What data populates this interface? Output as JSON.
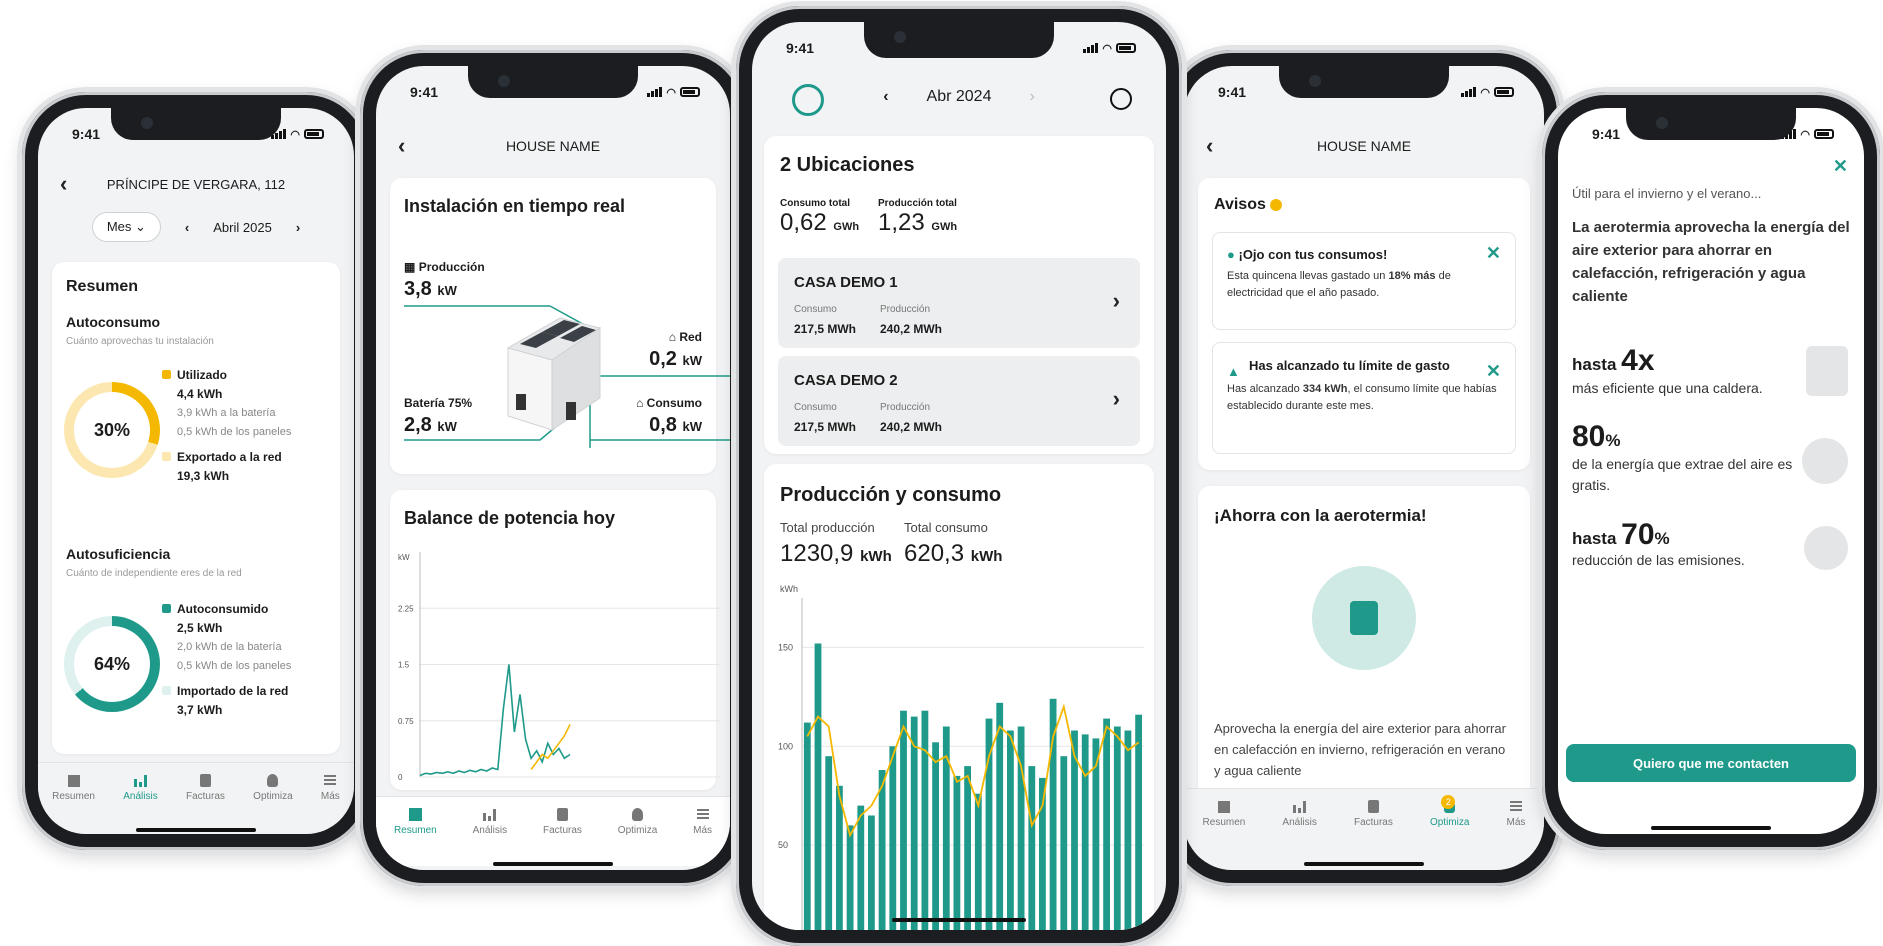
{
  "theme": {
    "accent": "#1f9a8a",
    "yellow": "#f5b800",
    "yellow_light": "#fde7b0",
    "teal_light": "#dff1ee"
  },
  "status_time": "9:41",
  "phone1": {
    "title": "PRÍNCIPE DE VERGARA, 112",
    "period_select": "Mes",
    "month": "Abril 2025",
    "summary_title": "Resumen",
    "autoconsumo": {
      "title": "Autoconsumo",
      "subtitle": "Cuánto aprovechas tu instalación",
      "percent": "30%",
      "percent_value": 0.3,
      "used_label": "Utilizado",
      "used_value": "4,4 kWh",
      "used_battery": "3,9 kWh a la batería",
      "used_panels": "0,5 kWh de los paneles",
      "exported_label": "Exportado a la red",
      "exported_value": "19,3 kWh"
    },
    "autosuficiencia": {
      "title": "Autosuficiencia",
      "subtitle": "Cuánto de independiente eres de la red",
      "percent": "64%",
      "percent_value": 0.64,
      "self_label": "Autoconsumido",
      "self_value": "2,5 kWh",
      "self_battery": "2,0 kWh de la batería",
      "self_panels": "0,5 kWh de los paneles",
      "imported_label": "Importado de la red",
      "imported_value": "3,7 kWh"
    },
    "tabs": [
      "Resumen",
      "Análisis",
      "Facturas",
      "Optimiza",
      "Más"
    ]
  },
  "phone2": {
    "title": "HOUSE NAME",
    "realtime_title": "Instalación en tiempo real",
    "production_label": "Producción",
    "production_value": "3,8",
    "grid_label": "Red",
    "grid_value": "0,2",
    "battery_label": "Batería 75%",
    "battery_value": "2,8",
    "consumption_label": "Consumo",
    "consumption_value": "0,8",
    "unit": "kW",
    "balance_title": "Balance de potencia hoy",
    "chart_unit": "kW",
    "yticks": [
      "2.25",
      "1.5",
      "0.75",
      "0"
    ],
    "tabs": [
      "Resumen",
      "Análisis",
      "Facturas",
      "Optimiza",
      "Más"
    ]
  },
  "phone3": {
    "month": "Abr 2024",
    "locations_title": "2 Ubicaciones",
    "total_consumption_label": "Consumo total",
    "total_consumption_value": "0,62",
    "total_production_label": "Producción total",
    "total_production_value": "1,23",
    "gwh": "GWh",
    "houses": [
      {
        "name": "CASA DEMO 1",
        "consumo_label": "Consumo",
        "consumo": "217,5 MWh",
        "produccion_label": "Producción",
        "produccion": "240,2 MWh"
      },
      {
        "name": "CASA DEMO 2",
        "consumo_label": "Consumo",
        "consumo": "217,5 MWh",
        "produccion_label": "Producción",
        "produccion": "240,2 MWh"
      }
    ],
    "prod_title": "Producción y consumo",
    "total_prod_label": "Total producción",
    "total_prod_value": "1230,9",
    "total_cons_label": "Total consumo",
    "total_cons_value": "620,3",
    "kwh": "kWh",
    "chart_unit": "kWh",
    "yticks": [
      "150",
      "100",
      "50"
    ]
  },
  "phone4": {
    "title": "HOUSE NAME",
    "alerts_title": "Avisos",
    "alert1_title": "¡Ojo con tus consumos!",
    "alert1_text_a": "Esta quincena llevas gastado un ",
    "alert1_text_b": "18% más",
    "alert1_text_c": " de electricidad que el año pasado.",
    "alert2_title": "Has alcanzado tu límite de gasto",
    "alert2_text_a": "Has alcanzado ",
    "alert2_text_b": "334 kWh",
    "alert2_text_c": ", el consumo límite que habías establecido durante este mes.",
    "promo_title": "¡Ahorra con la aerotermia!",
    "promo_text": "Aprovecha la energía del aire exterior para ahorrar en calefacción en invierno, refrigeración en verano y agua caliente",
    "optimiza_badge": "2",
    "tabs": [
      "Resumen",
      "Análisis",
      "Facturas",
      "Optimiza",
      "Más"
    ]
  },
  "phone5": {
    "intro": "Útil para el invierno y el verano...",
    "lead": "La aerotermia aprovecha la energía del aire exterior para ahorrar en calefacción, refrigeración y agua caliente",
    "stat1_prefix": "hasta ",
    "stat1_big": "4x",
    "stat1_text": "más eficiente que una caldera.",
    "stat2_big": "80",
    "stat2_unit": "%",
    "stat2_text": "de la energía que extrae del aire es gratis.",
    "stat3_prefix": "hasta ",
    "stat3_big": "70",
    "stat3_unit": "%",
    "stat3_text": "reducción de las emisiones.",
    "cta": "Quiero que me contacten"
  },
  "chart_data": [
    {
      "type": "line",
      "title": "Balance de potencia hoy",
      "ylabel": "kW",
      "ylim": [
        0,
        3
      ],
      "yticks": [
        0,
        0.75,
        1.5,
        2.25
      ],
      "series": [
        {
          "color": "#1f9a8a",
          "values": [
            0.02,
            0.05,
            0.04,
            0.06,
            0.05,
            0.07,
            0.05,
            0.08,
            0.06,
            0.09,
            0.07,
            0.1,
            0.08,
            0.12,
            0.1,
            0.9,
            1.5,
            0.6,
            1.1,
            0.5,
            0.25,
            0.35,
            0.2,
            0.45,
            0.3,
            0.38,
            0.25,
            0.3
          ]
        },
        {
          "color": "#f5b800",
          "values": [
            null,
            null,
            null,
            null,
            null,
            null,
            null,
            null,
            null,
            null,
            null,
            null,
            null,
            null,
            null,
            null,
            null,
            null,
            null,
            null,
            0.1,
            0.2,
            0.3,
            0.25,
            0.35,
            0.45,
            0.55,
            0.7
          ]
        }
      ]
    },
    {
      "type": "bar",
      "title": "Producción y consumo",
      "ylabel": "kWh",
      "ylim": [
        0,
        175
      ],
      "yticks": [
        50,
        100,
        150
      ],
      "series": [
        {
          "color": "#1f9a8a",
          "values": [
            112,
            152,
            95,
            80,
            60,
            70,
            65,
            88,
            100,
            118,
            115,
            118,
            102,
            110,
            85,
            90,
            76,
            114,
            122,
            108,
            110,
            90,
            84,
            124,
            95,
            108,
            106,
            104,
            114,
            110,
            108,
            116
          ]
        },
        {
          "color": "#f5b800",
          "values": [
            105,
            115,
            110,
            75,
            55,
            65,
            70,
            80,
            95,
            110,
            100,
            98,
            92,
            95,
            82,
            85,
            70,
            95,
            110,
            105,
            90,
            60,
            70,
            105,
            120,
            95,
            85,
            90,
            110,
            105,
            98,
            102
          ]
        }
      ]
    }
  ]
}
